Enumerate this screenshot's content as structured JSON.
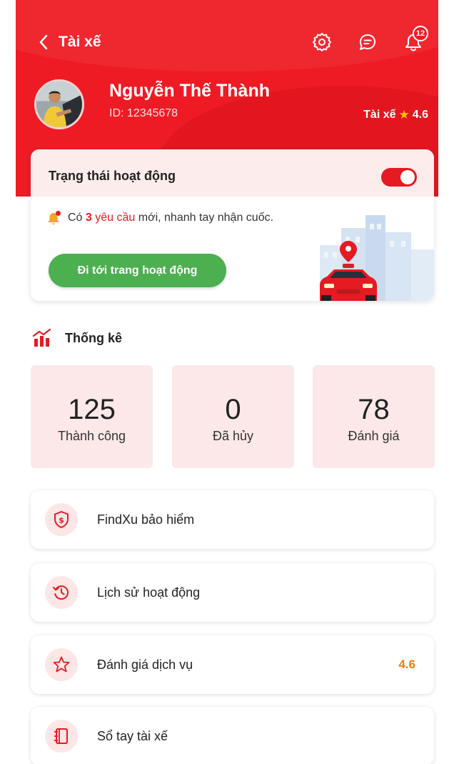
{
  "colors": {
    "brand_red": "#ee1b24",
    "success_green": "#4caf50",
    "rating_orange": "#f57c00",
    "star_gold": "#ffc107"
  },
  "header": {
    "title": "Tài xế",
    "icons": [
      "back-chevron-icon",
      "settings-gear-icon",
      "chat-bubble-icon",
      "bell-icon"
    ],
    "notification_count": "12"
  },
  "profile": {
    "name": "Nguyễn Thế Thành",
    "id": "ID: 12345678",
    "role": "Tài xế",
    "rating": "4.6"
  },
  "status_card": {
    "title": "Trạng thái hoạt động",
    "toggle_on": true,
    "notice_prefix": "Có",
    "notice_count": "3",
    "notice_highlight": "yêu cầu",
    "notice_suffix": "mới, nhanh tay nhận cuốc.",
    "button_label": "Đi tới trang hoạt động"
  },
  "stats": {
    "title": "Thống kê",
    "items": [
      {
        "value": "125",
        "label": "Thành công"
      },
      {
        "value": "0",
        "label": "Đã hủy"
      },
      {
        "value": "78",
        "label": "Đánh giá"
      }
    ]
  },
  "menu": [
    {
      "label": "FindXu bảo hiểm",
      "icon": "shield-dollar-icon",
      "value": ""
    },
    {
      "label": "Lịch sử hoạt động",
      "icon": "history-clock-icon",
      "value": ""
    },
    {
      "label": "Đánh giá dịch vụ",
      "icon": "star-outline-icon",
      "value": "4.6"
    },
    {
      "label": "Sổ tay tài xế",
      "icon": "notebook-icon",
      "value": ""
    }
  ]
}
